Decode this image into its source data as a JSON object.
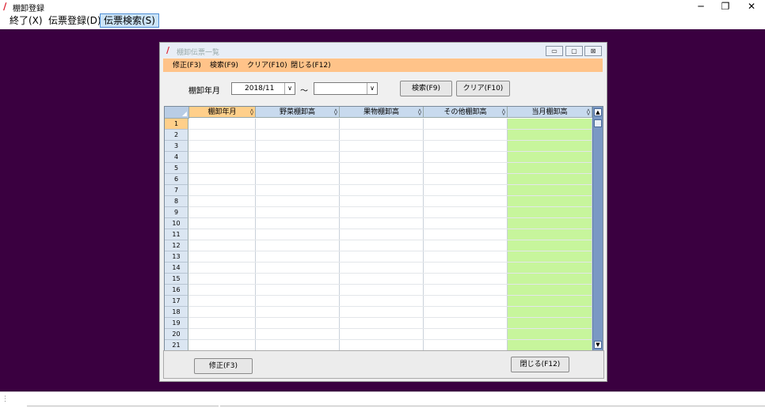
{
  "window": {
    "title": "棚卸登録",
    "minimize": "─",
    "restore": "❐",
    "close": "✕"
  },
  "menu": [
    {
      "label": "終了(X)"
    },
    {
      "label": "伝票登録(D)"
    },
    {
      "label": "伝票検索(S)"
    }
  ],
  "child": {
    "title": "棚卸伝票一覧",
    "controls": {
      "minimize": "▭",
      "maximize": "▢",
      "close": "⊠"
    },
    "menu": [
      {
        "label": "修正(F3)"
      },
      {
        "label": "検索(F9)"
      },
      {
        "label": "クリア(F10)"
      },
      {
        "label": "閉じる(F12)"
      }
    ],
    "filter": {
      "label": "棚卸年月",
      "from_value": "2018/11",
      "tilde": "～",
      "to_value": "",
      "search_button": "検索(F9)",
      "clear_button": "クリア(F10)"
    },
    "grid": {
      "columns": [
        "棚卸年月",
        "野菜棚卸高",
        "果物棚卸高",
        "その他棚卸高",
        "当月棚卸高"
      ],
      "sort_glyph": "◊",
      "rows": [
        "1",
        "2",
        "3",
        "4",
        "5",
        "6",
        "7",
        "8",
        "9",
        "10",
        "11",
        "12",
        "13",
        "14",
        "15",
        "16",
        "17",
        "18",
        "19",
        "20",
        "21"
      ],
      "highlight_color": "#c7f59c",
      "scroll_up": "▲",
      "scroll_down": "▼"
    },
    "footer": {
      "edit_button": "修正(F3)",
      "close_button": "閉じる(F12)"
    }
  },
  "colors": {
    "desktop": "#3a0040",
    "menu_bar": "#ffc389",
    "selected_header": "#ffcf8a"
  }
}
